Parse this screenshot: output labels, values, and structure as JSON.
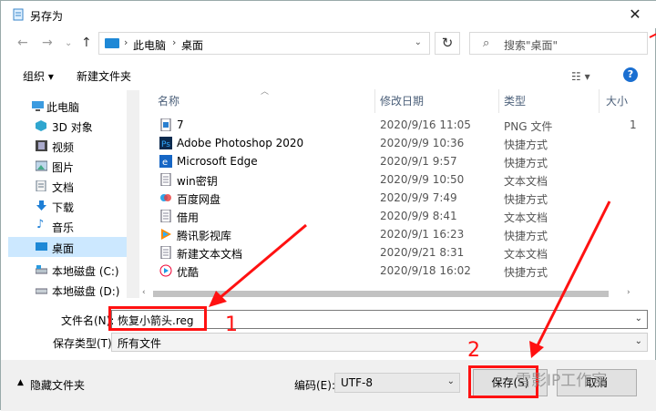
{
  "window": {
    "title": "另存为"
  },
  "address": {
    "crumbs": [
      "此电脑",
      "桌面"
    ]
  },
  "search": {
    "placeholder": "搜索\"桌面\""
  },
  "toolbar": {
    "organize": "组织 ▾",
    "new_folder": "新建文件夹"
  },
  "sidebar": {
    "items": [
      {
        "label": "此电脑",
        "icon": "computer-icon"
      },
      {
        "label": "3D 对象",
        "icon": "cube-icon"
      },
      {
        "label": "视频",
        "icon": "video-icon"
      },
      {
        "label": "图片",
        "icon": "picture-icon"
      },
      {
        "label": "文档",
        "icon": "document-icon"
      },
      {
        "label": "下载",
        "icon": "download-icon"
      },
      {
        "label": "音乐",
        "icon": "music-icon"
      },
      {
        "label": "桌面",
        "icon": "desktop-icon",
        "selected": true
      },
      {
        "label": "本地磁盘 (C:)",
        "icon": "drive-icon"
      },
      {
        "label": "本地磁盘 (D:)",
        "icon": "drive-icon"
      }
    ]
  },
  "columns": {
    "name": "名称",
    "date": "修改日期",
    "type": "类型",
    "size": "大小"
  },
  "files": [
    {
      "name": "7",
      "date": "2020/9/16 11:05",
      "type": "PNG 文件",
      "size": "1",
      "icon": "png-file-icon"
    },
    {
      "name": "Adobe Photoshop 2020",
      "date": "2020/9/9 10:36",
      "type": "快捷方式",
      "size": "",
      "icon": "photoshop-icon"
    },
    {
      "name": "Microsoft Edge",
      "date": "2020/9/1 9:57",
      "type": "快捷方式",
      "size": "",
      "icon": "edge-icon"
    },
    {
      "name": "win密钥",
      "date": "2020/9/9 10:50",
      "type": "文本文档",
      "size": "",
      "icon": "text-file-icon"
    },
    {
      "name": "百度网盘",
      "date": "2020/9/9 7:49",
      "type": "快捷方式",
      "size": "",
      "icon": "baidu-netdisk-icon"
    },
    {
      "name": "借用",
      "date": "2020/9/9 8:41",
      "type": "文本文档",
      "size": "",
      "icon": "text-file-icon"
    },
    {
      "name": "腾讯影视库",
      "date": "2020/9/1 16:23",
      "type": "快捷方式",
      "size": "",
      "icon": "tencent-video-icon"
    },
    {
      "name": "新建文本文档",
      "date": "2020/9/21 8:31",
      "type": "文本文档",
      "size": "",
      "icon": "text-file-icon"
    },
    {
      "name": "优酷",
      "date": "2020/9/18 16:02",
      "type": "快捷方式",
      "size": "",
      "icon": "youku-icon"
    }
  ],
  "form": {
    "filename_label": "文件名(N):",
    "filename_value": "恢复小箭头.reg",
    "filetype_label": "保存类型(T):",
    "filetype_value": "所有文件"
  },
  "footer": {
    "hide_folders": "隐藏文件夹",
    "encoding_label": "编码(E):",
    "encoding_value": "UTF-8",
    "save": "保存(S)",
    "cancel": "取消"
  },
  "annotations": {
    "step1": "1",
    "step2": "2",
    "color": "#ff1111"
  },
  "watermark": "雪影IP工作室"
}
